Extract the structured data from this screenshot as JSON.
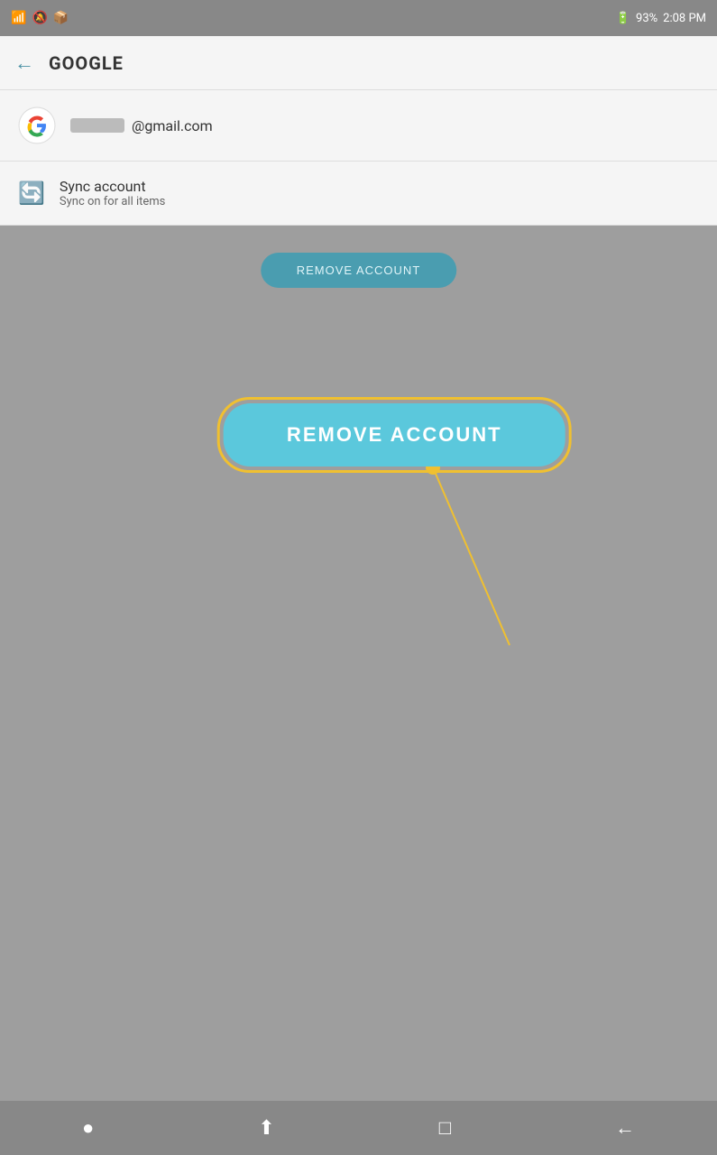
{
  "statusBar": {
    "battery": "93%",
    "time": "2:08 PM",
    "icons": [
      "notification",
      "mute",
      "wifi",
      "signal"
    ]
  },
  "header": {
    "title": "GOOGLE",
    "backLabel": "←"
  },
  "account": {
    "email_suffix": "@gmail.com",
    "email_blur_placeholder": "redacted"
  },
  "sync": {
    "title": "Sync account",
    "subtitle": "Sync on for all items"
  },
  "removeButton": {
    "label": "REMOVE ACCOUNT",
    "label_large": "REMOVE ACCOUNT"
  },
  "nav": {
    "dot": "●",
    "menu": "⬆",
    "home": "□",
    "back": "←"
  }
}
